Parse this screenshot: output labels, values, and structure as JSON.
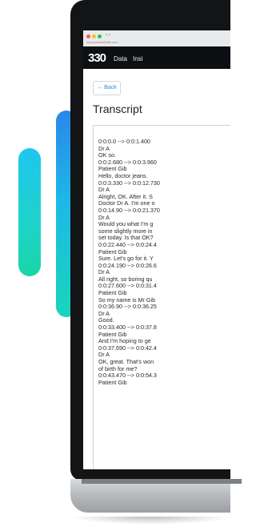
{
  "browser": {
    "nav_controls": "‹ ›",
    "url": "www.yourwebsite.com"
  },
  "header": {
    "logo": "330",
    "nav": [
      "Data",
      "Insi"
    ]
  },
  "page": {
    "back_label": "← Back",
    "title": "Transcript"
  },
  "transcript": [
    "0:0:0.0 --> 0:0:1.400",
    "Dr A",
    "OK so.",
    "0:0:2.680 --> 0:0:3.960",
    "Patient Gib",
    "Hello, doctor jeans.",
    "0:0:3.330 --> 0:0:12.730",
    "Dr A",
    "Alright, OK. After it. S",
    "Doctor Dr A. I'm one o",
    "0:0:14.90 --> 0:0:21.370",
    "Dr A",
    "Would you what I'm g",
    "some slightly more in",
    "set today. Is that OK?",
    "0:0:22.440 --> 0:0:24.4",
    "Patient Gib",
    "Sure. Let's go for it. Y",
    "0:0:24.190 --> 0:0:26.6",
    "Dr A",
    "All right, so boring qu",
    "0:0:27.600 --> 0:0:31.4",
    "Patient Gib",
    "So my name is Mr Gib",
    "0:0:36.90 --> 0:0:36.25",
    "Dr A",
    "Good.",
    "0:0:33.400 --> 0:0:37.8",
    "Patient Gib",
    "And I'm hoping to ge",
    "0:0:37.690 --> 0:0:42.4",
    "Dr A",
    "OK, great. That's won",
    "of birth for me?",
    "0:0:43.470 --> 0:0:54.3",
    "Patient Gib"
  ],
  "colors": {
    "bar_left_top": "#1fc6ef",
    "bar_mid_top": "#2b86ea",
    "bar_bottom": "#19d6a6",
    "appbar": "#0d0f12",
    "link": "#2b8bd8"
  }
}
